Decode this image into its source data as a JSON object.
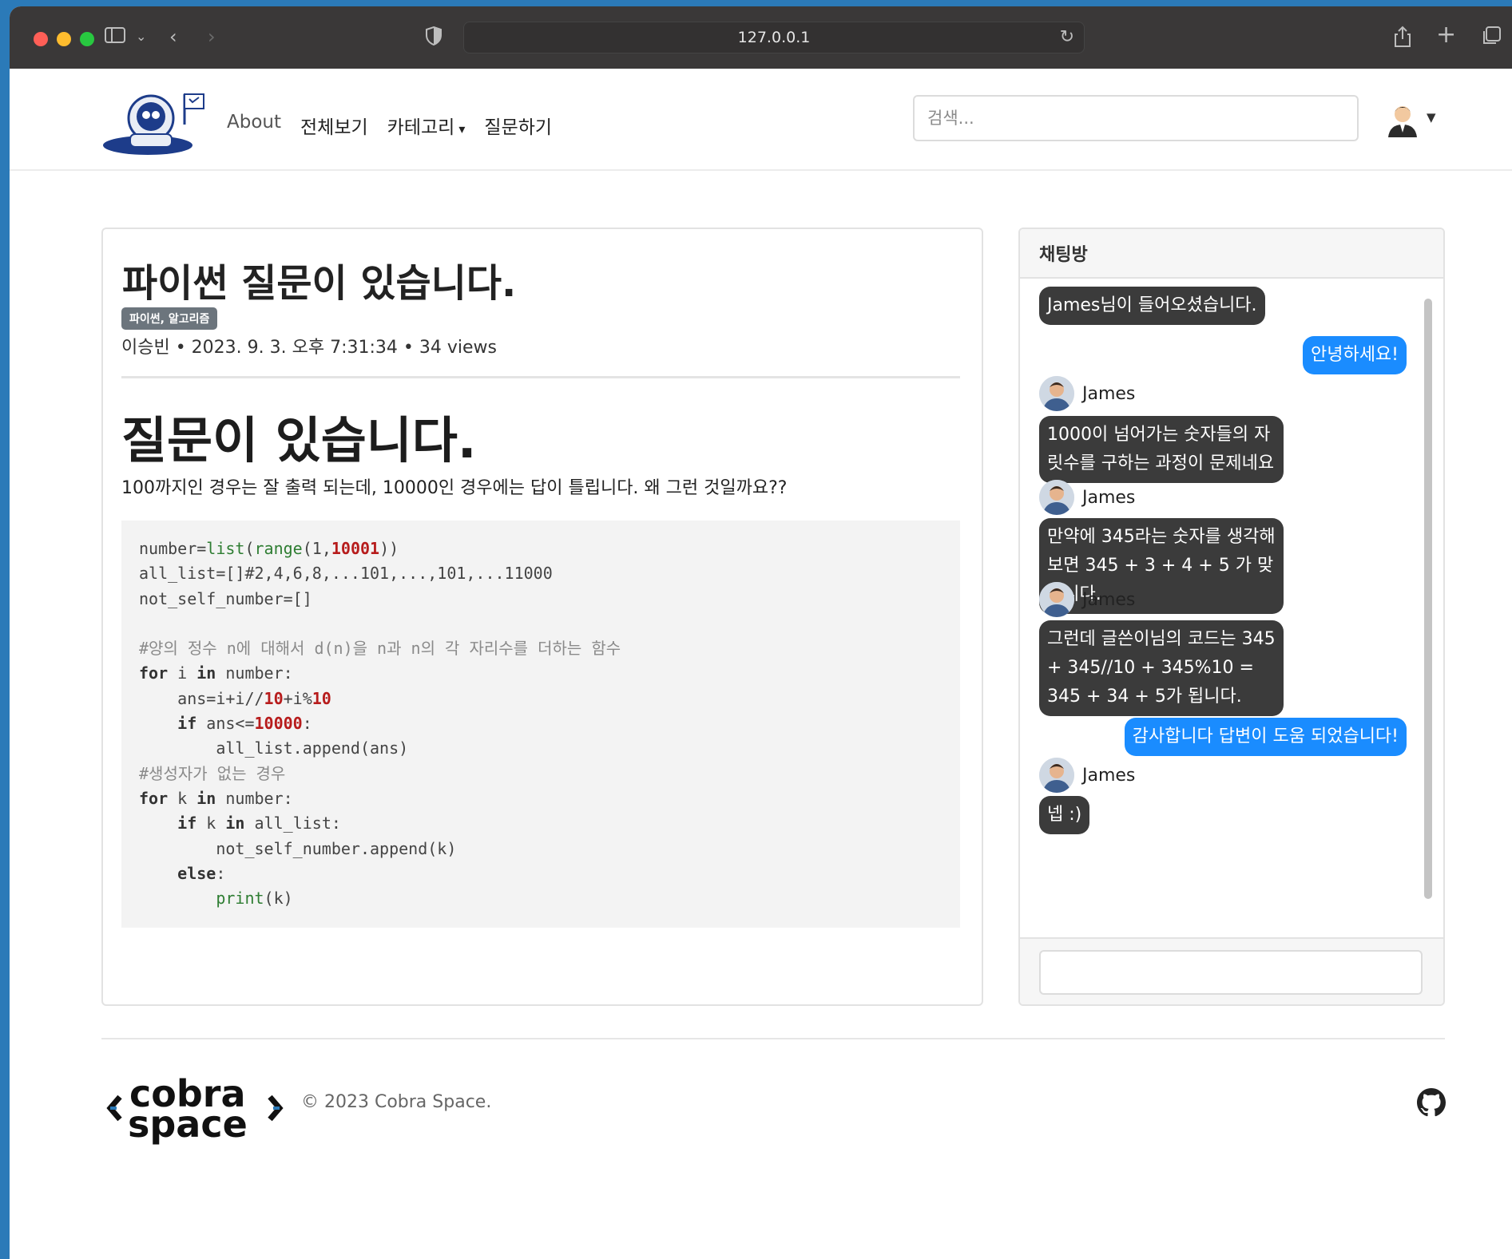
{
  "browser": {
    "url": "127.0.0.1"
  },
  "nav": {
    "links": [
      "About",
      "전체보기",
      "카테고리",
      "질문하기"
    ],
    "search_placeholder": "검색..."
  },
  "post": {
    "title": "파이썬 질문이 있습니다.",
    "badge": "파이썬, 알고리즘",
    "author": "이승빈",
    "date": "2023. 9. 3. 오후 7:31:34",
    "views": "34 views",
    "meta": "이승빈 • 2023. 9. 3. 오후 7:31:34 • 34 views",
    "heading": "질문이 있습니다.",
    "body": "100까지인 경우는 잘 출력 되는데, 10000인 경우에는 답이 틀립니다. 왜 그런 것일까요??",
    "code_lines": [
      "number=list(range(1,10001))",
      "all_list=[]#2,4,6,8,...101,...,101,...11000",
      "not_self_number=[]",
      "",
      "#양의 정수 n에 대해서 d(n)을 n과 n의 각 자리수를 더하는 함수",
      "for i in number:",
      "    ans=i+i//10+i%10",
      "    if ans<=10000:",
      "        all_list.append(ans)",
      "#생성자가 없는 경우",
      "for k in number:",
      "    if k in all_list:",
      "        not_self_number.append(k)",
      "    else:",
      "        print(k)"
    ]
  },
  "chat": {
    "title": "채팅방",
    "messages": [
      {
        "type": "system",
        "text": "James님이 들어오셨습니다."
      },
      {
        "type": "me",
        "text": "안녕하세요!"
      },
      {
        "type": "other",
        "sender": "James",
        "text": "1000이 넘어가는 숫자들의 자릿수를 구하는 과정이 문제네요"
      },
      {
        "type": "other",
        "sender": "James",
        "text": "만약에 345라는 숫자를 생각해보면 345 + 3 + 4 + 5 가 맞습니다."
      },
      {
        "type": "other",
        "sender": "James",
        "text": "그런데 글쓴이님의 코드는 345 + 345//10 + 345%10 = 345 + 34 + 5가 됩니다."
      },
      {
        "type": "me",
        "text": "감사합니다 답변이 도움 되었습니다!"
      },
      {
        "type": "other",
        "sender": "James",
        "text": "넵 :)"
      }
    ]
  },
  "footer": {
    "copyright": "© 2023 Cobra Space.",
    "logo_text": "cobra space"
  },
  "colors": {
    "chat_dark": "#3b3b3b",
    "chat_blue": "#1a8cff",
    "badge": "#6c757d"
  }
}
